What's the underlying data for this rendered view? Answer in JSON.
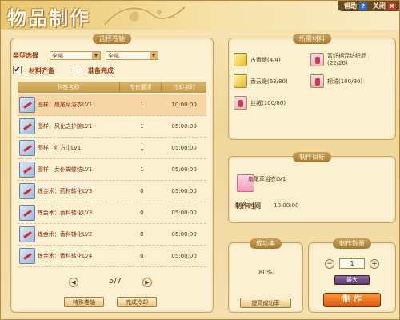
{
  "window": {
    "title": "物品制作",
    "help_label": "帮助",
    "help_icon_glyph": "?",
    "close_label": "关闭",
    "close_icon_glyph": "X"
  },
  "select_scroll": {
    "section_title": "选择卷轴",
    "type_label": "类型选择",
    "type_value_1": "全部",
    "type_value_2": "全部",
    "materials_ready_label": "材料齐备",
    "materials_ready_checked": true,
    "prep_done_label": "准备完成",
    "prep_done_checked": false,
    "columns": [
      "科技名称",
      "专长要求",
      "冷却余时"
    ],
    "rows": [
      {
        "name": "图样：扇尾草浴衣LV1",
        "skill": "1",
        "cooldown": "10:00:00",
        "selected": true
      },
      {
        "name": "图样：风化之护腕LV1",
        "skill": "1",
        "cooldown": "05:00:00"
      },
      {
        "name": "图样：红方巾LV1",
        "skill": "1",
        "cooldown": "05:00:00"
      },
      {
        "name": "图样：女仆蝴蝶结LV1",
        "skill": "1",
        "cooldown": "05:00:00"
      },
      {
        "name": "炼金术：药材转化LV3",
        "skill": "0",
        "cooldown": "05:00:00"
      },
      {
        "name": "炼金术：香料转化LV3",
        "skill": "0",
        "cooldown": "05:00:00"
      },
      {
        "name": "炼金术：香料转化LV2",
        "skill": "0",
        "cooldown": "05:00:00"
      },
      {
        "name": "炼金术：香料转化LV4",
        "skill": "0",
        "cooldown": "05:00:00"
      }
    ],
    "page": "5/7",
    "prev_icon": "◀",
    "next_icon": "▶",
    "special_scroll_button": "特殊卷轴",
    "finish_cooldown_button": "完成冷却"
  },
  "materials": {
    "section_title": "所需材料",
    "items": [
      {
        "name": "古香缎(4/4)",
        "icon": "gold-cloth-icon"
      },
      {
        "name": "富纤棉混纺织品\n(22/20)",
        "icon": "bottle-icon"
      },
      {
        "name": "香云缎(63/80)",
        "icon": "gold-cloth-icon"
      },
      {
        "name": "棉绒(100/80)",
        "icon": "bottle-icon"
      },
      {
        "name": "丝绒(100/80)",
        "icon": "bottle-icon"
      }
    ]
  },
  "target": {
    "section_title": "制作目标",
    "item_name": "扇尾草浴衣LV1",
    "time_label": "制作时间",
    "time_value": "10:00:00"
  },
  "success": {
    "section_title": "成功率",
    "rate": "80%",
    "improve_button": "提高成功率"
  },
  "quantity": {
    "section_title": "制作数量",
    "minus": "−",
    "value": "1",
    "plus": "+",
    "max_label": "最大",
    "make_button": "制 作"
  }
}
